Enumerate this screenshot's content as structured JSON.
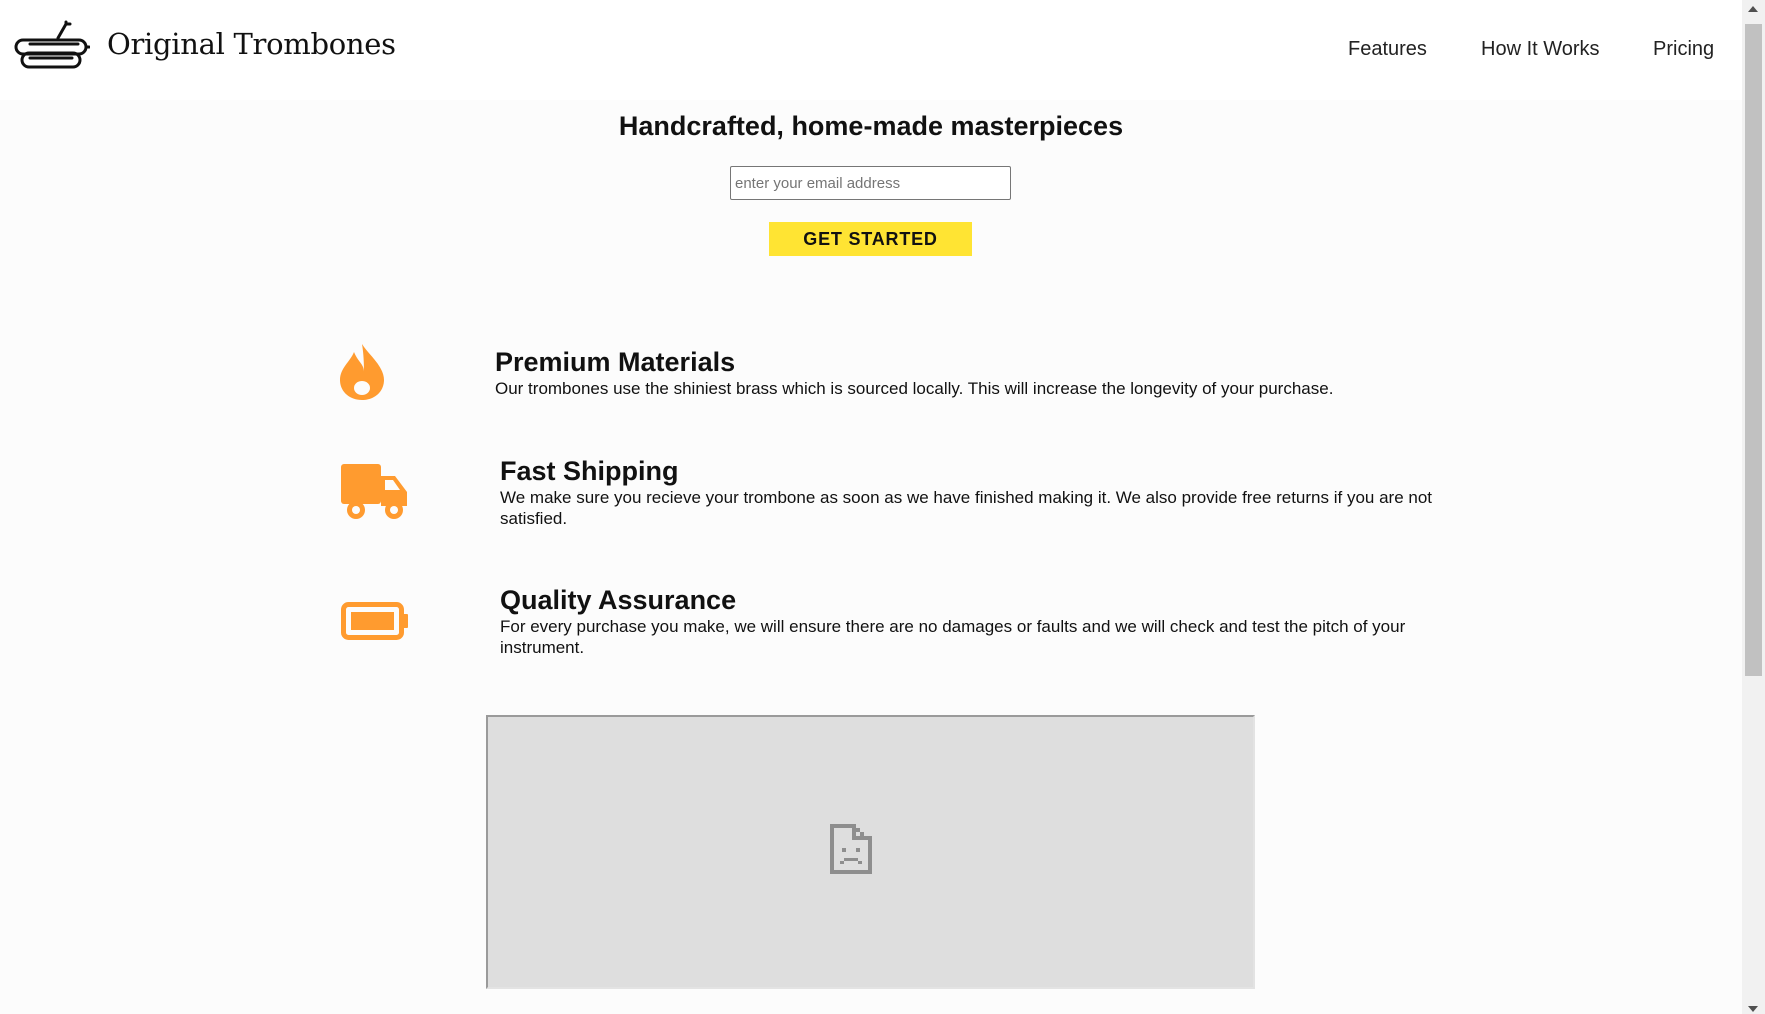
{
  "header": {
    "brand_name": "Original Trombones",
    "logo_icon": "trombone-icon",
    "nav": [
      {
        "label": "Features"
      },
      {
        "label": "How It Works"
      },
      {
        "label": "Pricing"
      }
    ]
  },
  "hero": {
    "title": "Handcrafted, home-made masterpieces",
    "email_placeholder": "enter your email address",
    "email_value": "",
    "cta_label": "GET STARTED"
  },
  "features": [
    {
      "icon": "flame-icon",
      "title": "Premium Materials",
      "description": "Our trombones use the shiniest brass which is sourced locally. This will increase the longevity of your purchase."
    },
    {
      "icon": "truck-icon",
      "title": "Fast Shipping",
      "description": "We make sure you recieve your trombone as soon as we have finished making it. We also provide free returns if you are not satisfied."
    },
    {
      "icon": "battery-icon",
      "title": "Quality Assurance",
      "description": "For every purchase you make, we will ensure there are no damages or faults and we will check and test the pitch of your instrument."
    }
  ],
  "video": {
    "icon": "broken-file-icon"
  },
  "colors": {
    "accent_orange": "#ff9b2f",
    "cta_yellow": "#ffe433",
    "page_background": "#fcfcfc"
  }
}
